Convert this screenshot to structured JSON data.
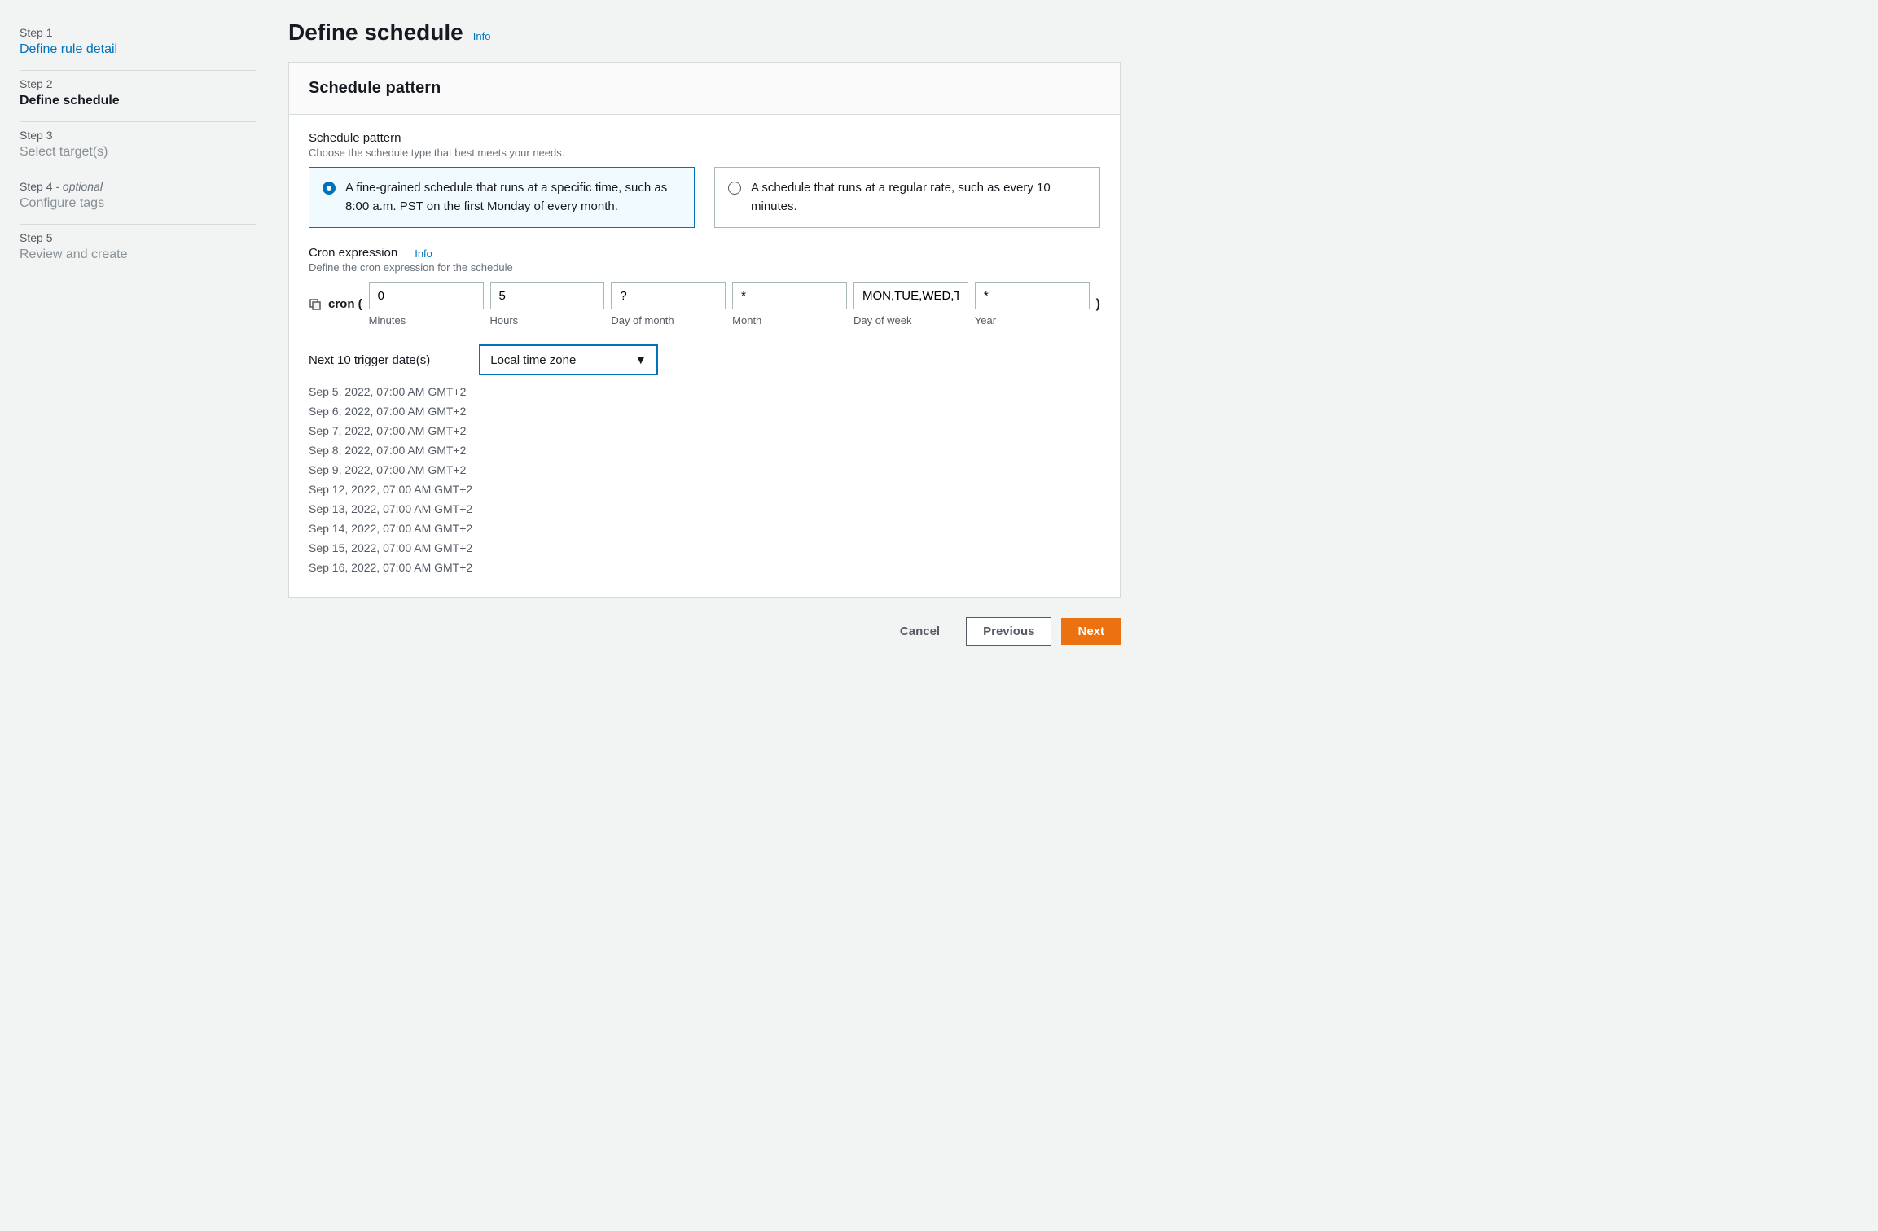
{
  "sidebar": {
    "steps": [
      {
        "label": "Step 1",
        "title": "Define rule detail"
      },
      {
        "label": "Step 2",
        "title": "Define schedule"
      },
      {
        "label": "Step 3",
        "title": "Select target(s)"
      },
      {
        "label": "Step 4",
        "optional": "- optional",
        "title": "Configure tags"
      },
      {
        "label": "Step 5",
        "title": "Review and create"
      }
    ]
  },
  "page": {
    "title": "Define schedule",
    "info": "Info"
  },
  "panel": {
    "title": "Schedule pattern",
    "pattern_label": "Schedule pattern",
    "pattern_help": "Choose the schedule type that best meets your needs.",
    "option_fine": "A fine-grained schedule that runs at a specific time, such as 8:00 a.m. PST on the first Monday of every month.",
    "option_rate": "A schedule that runs at a regular rate, such as every 10 minutes.",
    "cron_label": "Cron expression",
    "cron_info": "Info",
    "cron_help": "Define the cron expression for the schedule",
    "cron_prefix": "cron (",
    "cron_suffix": ")",
    "fields": {
      "minutes": {
        "value": "0",
        "label": "Minutes"
      },
      "hours": {
        "value": "5",
        "label": "Hours"
      },
      "dom": {
        "value": "?",
        "label": "Day of month"
      },
      "month": {
        "value": "*",
        "label": "Month"
      },
      "dow": {
        "value": "MON,TUE,WED,THU,FRI",
        "label": "Day of week"
      },
      "year": {
        "value": "*",
        "label": "Year"
      }
    },
    "trigger_label": "Next 10 trigger date(s)",
    "tz_selected": "Local time zone",
    "trigger_dates": [
      "Sep 5, 2022, 07:00 AM GMT+2",
      "Sep 6, 2022, 07:00 AM GMT+2",
      "Sep 7, 2022, 07:00 AM GMT+2",
      "Sep 8, 2022, 07:00 AM GMT+2",
      "Sep 9, 2022, 07:00 AM GMT+2",
      "Sep 12, 2022, 07:00 AM GMT+2",
      "Sep 13, 2022, 07:00 AM GMT+2",
      "Sep 14, 2022, 07:00 AM GMT+2",
      "Sep 15, 2022, 07:00 AM GMT+2",
      "Sep 16, 2022, 07:00 AM GMT+2"
    ]
  },
  "footer": {
    "cancel": "Cancel",
    "previous": "Previous",
    "next": "Next"
  }
}
